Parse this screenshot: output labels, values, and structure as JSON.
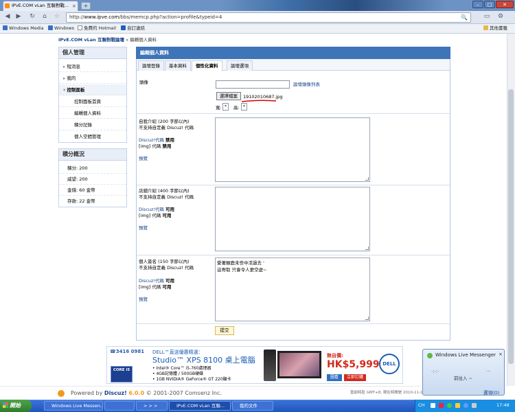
{
  "browser": {
    "tab_title": "IPvE.COM vLan 互聯對戰...",
    "tab_close": "×",
    "new_tab": "+",
    "url_prefix": "http://",
    "url_domain": "www.ipve.com",
    "url_path": "/bbs/memcp.php?action=profile&typeid=4",
    "bookmarks": [
      "Windows Media",
      "Windows",
      "免費的 Hotmail",
      "自訂連結"
    ],
    "other_bookmarks": "其他書籤"
  },
  "page": {
    "breadcrumb_site": "IPvE.COM vLan 互聯對戰論壇",
    "breadcrumb_sep": "»",
    "breadcrumb_current": "編輯個人資料"
  },
  "sidebar": {
    "manage_title": "個人管理",
    "items": [
      "短消息",
      "我的",
      "控制面板",
      "控制面板首頁",
      "編輯個人資料",
      "積分記錄",
      "個人空間管理"
    ],
    "credits_title": "積分概況",
    "credits": [
      "積分: 200",
      "威望: 200",
      "金錢: 60 金幣",
      "存款: 22 金幣"
    ]
  },
  "main": {
    "header": "編輯個人資料",
    "tabs": [
      "論壇登錄",
      "基本資料",
      "個性化資料",
      "論壇選項"
    ],
    "avatar_label": "頭像",
    "avatar_list_link": "論壇頭像列表",
    "choose_file": "選擇檔案",
    "file_name": "19102010687.jpg",
    "width_label": "寬:",
    "width_value": "*",
    "height_label": "高:",
    "height_value": "*",
    "bio_label": "自我介紹 (200 字節以內)",
    "bio_note": "不支持自定義 Discuz! 代碼",
    "bio_code_label": "Discuz!代碼",
    "bio_code_state": "禁用",
    "bio_img_label": "[img] 代碼",
    "bio_img_state": "禁用",
    "bio_preview": "預覽",
    "shop_label": "店鋪介紹 (400 字節以內)",
    "shop_note": "不支持自定義 Discuz! 代碼",
    "shop_code_label": "Discuz!代碼",
    "shop_code_state": "可用",
    "shop_img_label": "[img] 代碼",
    "shop_img_state": "可用",
    "shop_preview": "預覽",
    "sig_label": "個人簽名 (150 字節以內)",
    "sig_note": "不支持自定義 Discuz! 代碼",
    "sig_code_label": "Discuz!代碼",
    "sig_code_state": "可用",
    "sig_img_label": "[img] 代碼",
    "sig_img_state": "可用",
    "sig_preview": "預覽",
    "sig_line1": "愛著類鹿未世中活過去 '",
    "sig_line2": "這寄取 只會令人更空虛~",
    "submit": "提交"
  },
  "ad": {
    "phone": "3416 0981",
    "title1": "DELL™直送優惠精選：",
    "title2": "Studio™ XPS 8100 桌上電腦",
    "spec1": "• Intel® Core™ i5-760處理器",
    "spec2": "• 4GB記憶體 / 500GB硬碟",
    "spec3": "• 1GB NVIDIA® GeForce® GT 220顯卡",
    "price_label": "無自價:",
    "price": "HK$5,999",
    "btn1": "圖看",
    "btn2": "立即訂購",
    "badge": "CORE i5",
    "brand": "DELL"
  },
  "footer": {
    "powered": "Powered by",
    "product": "Discuz!",
    "version": "6.0.0",
    "copyright": "© 2001-2007",
    "company": "Comsenz Inc.",
    "time": "當前時區 GMT+8, 現在時間是 2010-11-1 17:48"
  },
  "messenger": {
    "title": "Windows Live Messenger",
    "status": "前往入 ~",
    "options": "選項(O)"
  },
  "taskbar": {
    "start": "開始",
    "tasks": [
      "Windows Live Messen...",
      "",
      "> > >",
      "IPvE.COM vLan 互聯...",
      "我的文件"
    ],
    "lang": "CH",
    "clock": "17:48"
  },
  "colors": {
    "header_blue": "#3e74b8",
    "link_blue": "#16428b",
    "annotation_red": "#d40000",
    "taskbar_blue": "#2258c2"
  }
}
